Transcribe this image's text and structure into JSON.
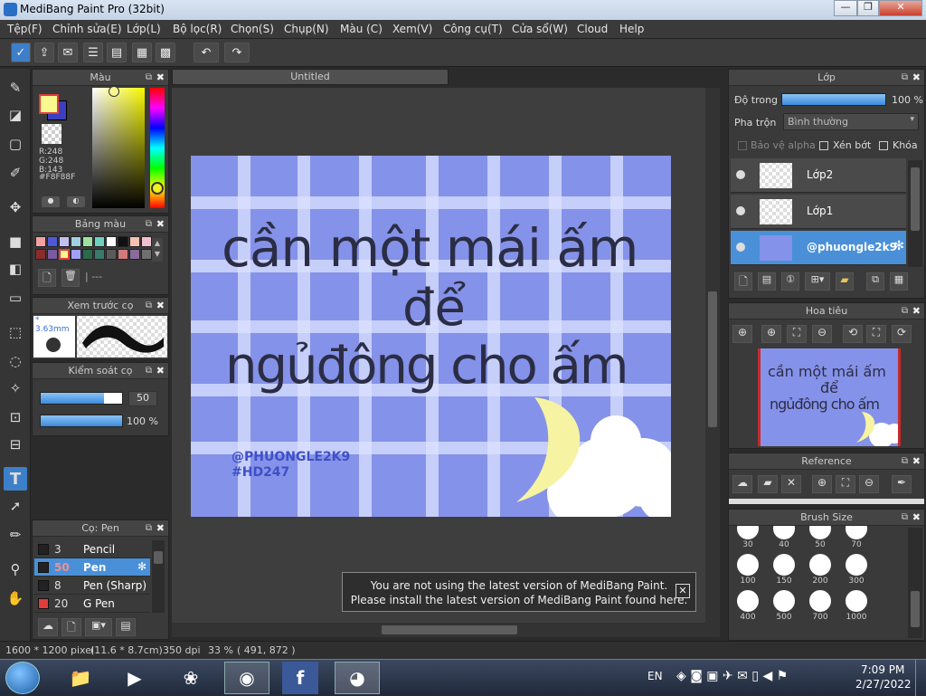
{
  "window": {
    "title": "MediBang Paint Pro (32bit)"
  },
  "menu": [
    "Tệp(F)",
    "Chỉnh sửa(E)",
    "Lớp(L)",
    "Bộ lọc(R)",
    "Chọn(S)",
    "Chụp(N)",
    "Màu (C)",
    "Xem(V)",
    "Công cụ(T)",
    "Cửa sổ(W)",
    "Cloud",
    "Help"
  ],
  "color_panel": {
    "title": "Màu",
    "r": "R:248",
    "g": "G:248",
    "b": "B:143",
    "hex": "#F8F88F",
    "primary": "#f8f88f",
    "secondary": "#3b3fc0"
  },
  "palette_panel": {
    "title": "Bảng màu",
    "swatches": [
      "#f4a0a0",
      "#4f59d8",
      "#c0c0f0",
      "#9ed0e0",
      "#9ee09e",
      "#6fd0c0",
      "#ffffff",
      "#111111",
      "#f4c0b0",
      "#f0c0d0",
      "#8a2c2c",
      "#7a5aa0",
      "#f8f88f",
      "#a0a0f8",
      "#2a6a4a",
      "#3a7a6a",
      "#5a5a5a",
      "#d07a7a",
      "#8a6a9a",
      "#707070"
    ],
    "name": "---"
  },
  "brush_preview": {
    "title": "Xem trước cọ",
    "size": "* 3.63mm"
  },
  "control_panel": {
    "title": "Kiểm soát cọ",
    "size_value": "50",
    "opacity_value": "100 %",
    "size_fraction": 0.78,
    "opacity_fraction": 1.0
  },
  "brush_panel": {
    "title": "Cọ: Pen",
    "items": [
      {
        "size": "3",
        "name": "Pencil",
        "color": "#222222",
        "selected": false
      },
      {
        "size": "50",
        "name": "Pen",
        "color": "#222222",
        "selected": true
      },
      {
        "size": "8",
        "name": "Pen (Sharp)",
        "color": "#222222",
        "selected": false
      },
      {
        "size": "20",
        "name": "G Pen",
        "color": "#e23b3b",
        "selected": false
      }
    ]
  },
  "document": {
    "tab": "Untitled"
  },
  "artwork": {
    "line1": "cần một mái ấm",
    "line2": "để",
    "line3": "ngủđông cho ấm",
    "tag1": "@PHUONGLE2K9",
    "tag2": "#HD247"
  },
  "notice": {
    "line1": "You are not using the latest version of MediBang Paint.",
    "line2": "Please install the latest version of MediBang Paint found here."
  },
  "layer_panel": {
    "title": "Lớp",
    "opacity_label": "Độ trong",
    "opacity_value": "100 %",
    "opacity_fraction": 1.0,
    "blend_label": "Pha trộn",
    "blend_value": "Bình thường",
    "protect_alpha": "Bảo vệ alpha",
    "clip": "Xén bớt",
    "lock": "Khóa",
    "layers": [
      {
        "name": "Lớp2",
        "selected": false
      },
      {
        "name": "Lớp1",
        "selected": false
      },
      {
        "name": "@phuongle2k9",
        "selected": true
      }
    ]
  },
  "navigator_panel": {
    "title": "Hoa tiêu",
    "line1": "cần một mái ấm",
    "line2": "để",
    "line3": "ngủđông cho ấm"
  },
  "reference_panel": {
    "title": "Reference"
  },
  "brushsize_panel": {
    "title": "Brush Size",
    "sizes": [
      "30",
      "40",
      "50",
      "70",
      "100",
      "150",
      "200",
      "300",
      "400",
      "500",
      "700",
      "1000"
    ]
  },
  "status": {
    "dimensions": "1600 * 1200 pixel",
    "physical": "(11.6 * 8.7cm)",
    "dpi": "350 dpi",
    "zoom": "33 %",
    "coords": "( 491, 872 )"
  },
  "taskbar": {
    "lang": "EN",
    "time": "7:09 PM",
    "date": "2/27/2022"
  }
}
